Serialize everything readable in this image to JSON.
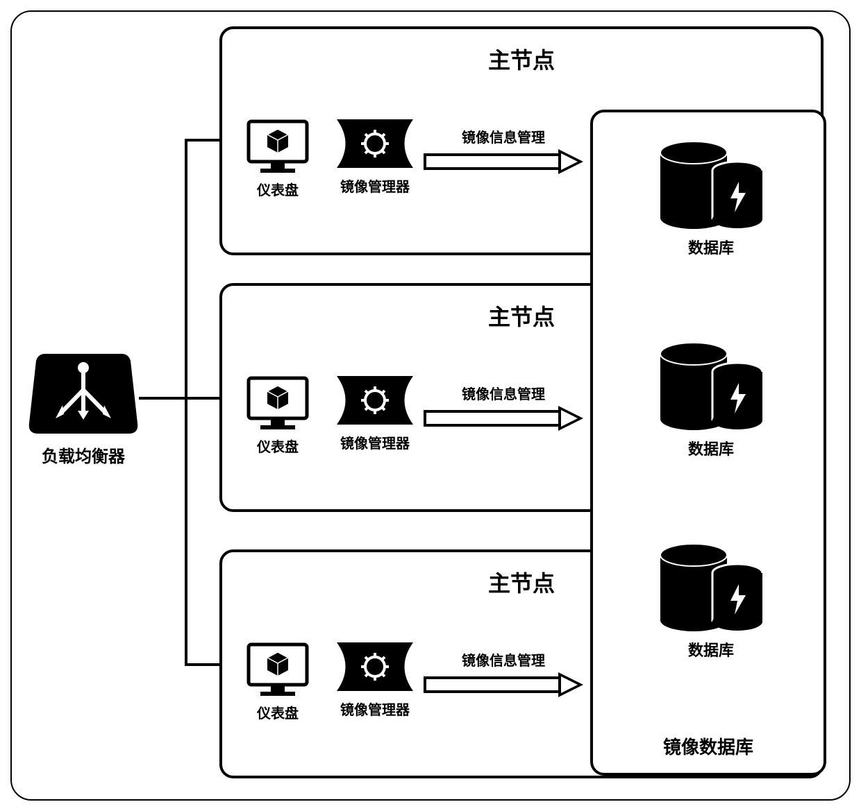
{
  "loadBalancer": {
    "label": "负载均衡器"
  },
  "nodes": [
    {
      "title": "主节点",
      "dashboard": "仪表盘",
      "mirrorMgr": "镜像管理器",
      "arrowLabel": "镜像信息管理"
    },
    {
      "title": "主节点",
      "dashboard": "仪表盘",
      "mirrorMgr": "镜像管理器",
      "arrowLabel": "镜像信息管理"
    },
    {
      "title": "主节点",
      "dashboard": "仪表盘",
      "mirrorMgr": "镜像管理器",
      "arrowLabel": "镜像信息管理"
    }
  ],
  "mirrorDb": {
    "title": "镜像数据库",
    "dbs": [
      {
        "label": "数据库"
      },
      {
        "label": "数据库"
      },
      {
        "label": "数据库"
      }
    ]
  }
}
